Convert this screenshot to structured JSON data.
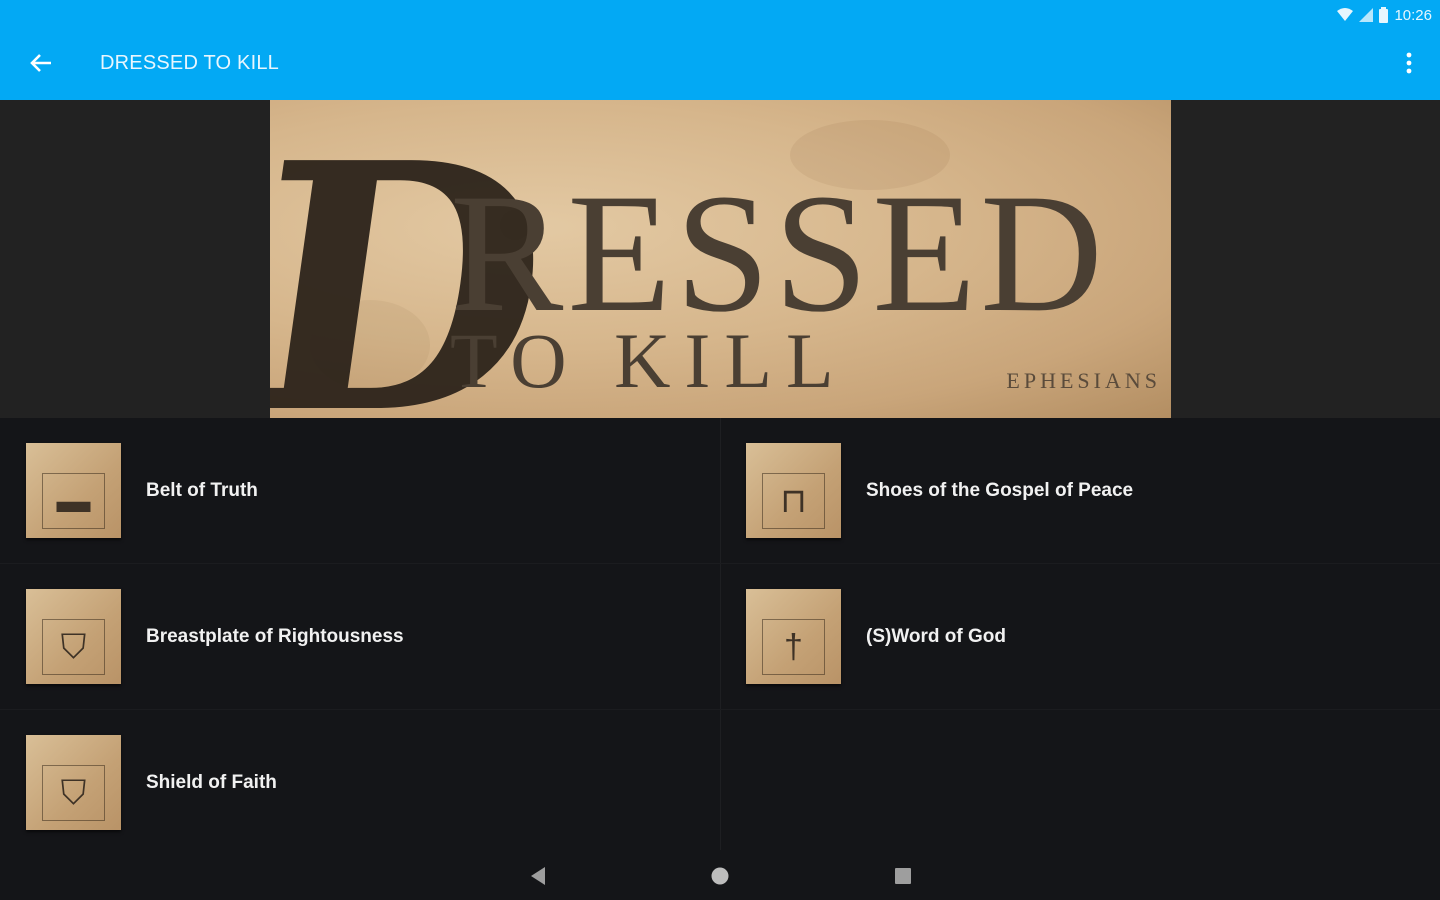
{
  "status_bar": {
    "time": "10:26",
    "icons": [
      "wifi-icon",
      "signal-icon",
      "battery-icon"
    ]
  },
  "app_bar": {
    "title": "DRESSED TO KILL",
    "color": "#03a9f4"
  },
  "hero": {
    "letter": "D",
    "word": "RESSED",
    "subtitle": "TO KILL",
    "book": "EPHESIANS"
  },
  "items": [
    {
      "label": "Belt of Truth",
      "icon": "belt-icon",
      "glyph": "▬"
    },
    {
      "label": "Shoes of the Gospel of Peace",
      "icon": "shoes-icon",
      "glyph": "⊓"
    },
    {
      "label": "Breastplate of Rightousness",
      "icon": "shield-icon",
      "glyph": "⛉"
    },
    {
      "label": "(S)Word of God",
      "icon": "cross-icon",
      "glyph": "†"
    },
    {
      "label": "Shield of Faith",
      "icon": "shield-icon",
      "glyph": "⛉"
    }
  ],
  "nav": {
    "buttons": [
      "back-nav-icon",
      "home-nav-icon",
      "recents-nav-icon"
    ]
  }
}
